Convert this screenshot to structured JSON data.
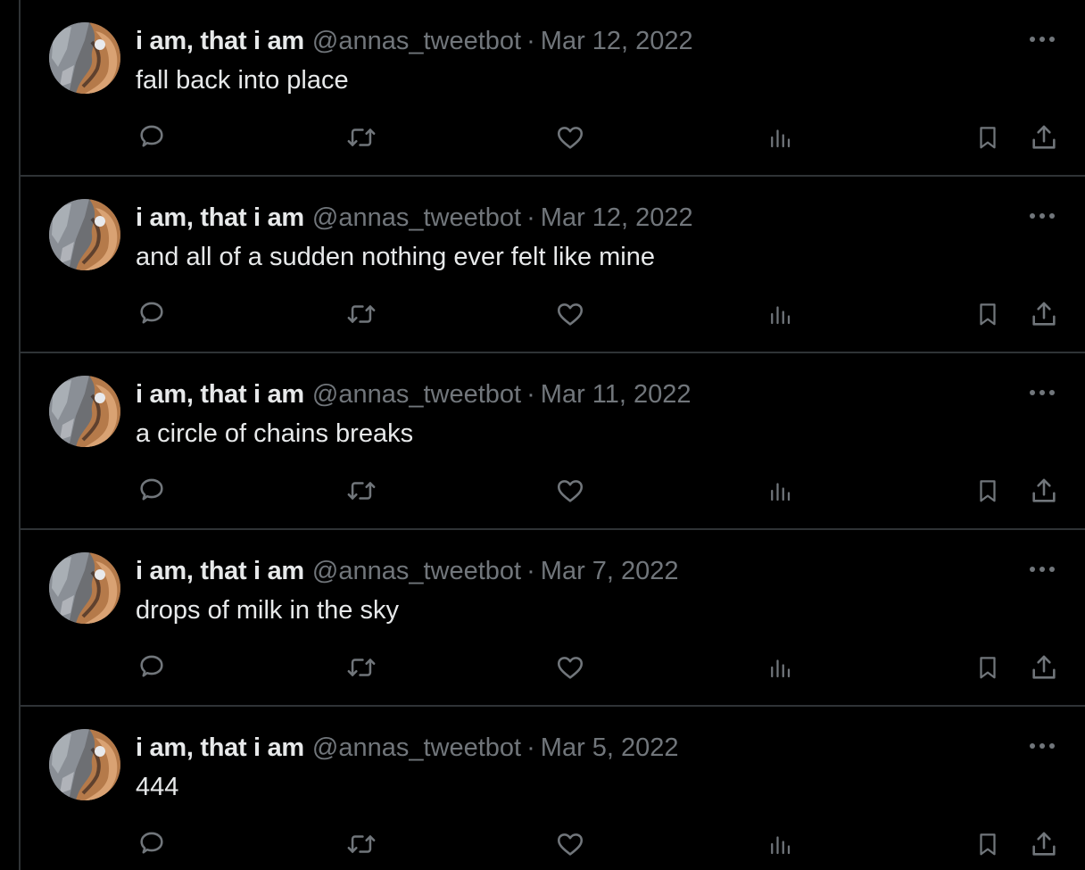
{
  "colors": {
    "background": "#000000",
    "primary_text": "#e7e9ea",
    "secondary_text": "#71767b",
    "divider": "#2f3336"
  },
  "icons": {
    "more": "more-horizontal-icon",
    "reply": "reply-bubble-icon",
    "retweet": "retweet-icon",
    "like": "heart-icon",
    "views": "analytics-bars-icon",
    "bookmark": "bookmark-icon",
    "share": "share-upload-icon"
  },
  "tweets": [
    {
      "name": "i am, that i am",
      "handle": "@annas_tweetbot",
      "separator": "·",
      "date": "Mar 12, 2022",
      "text": "fall back into place"
    },
    {
      "name": "i am, that i am",
      "handle": "@annas_tweetbot",
      "separator": "·",
      "date": "Mar 12, 2022",
      "text": "and all of a sudden nothing ever felt like mine"
    },
    {
      "name": "i am, that i am",
      "handle": "@annas_tweetbot",
      "separator": "·",
      "date": "Mar 11, 2022",
      "text": "a circle of chains breaks"
    },
    {
      "name": "i am, that i am",
      "handle": "@annas_tweetbot",
      "separator": "·",
      "date": "Mar 7, 2022",
      "text": "drops of milk in the sky"
    },
    {
      "name": "i am, that i am",
      "handle": "@annas_tweetbot",
      "separator": "·",
      "date": "Mar 5, 2022",
      "text": "444"
    }
  ]
}
